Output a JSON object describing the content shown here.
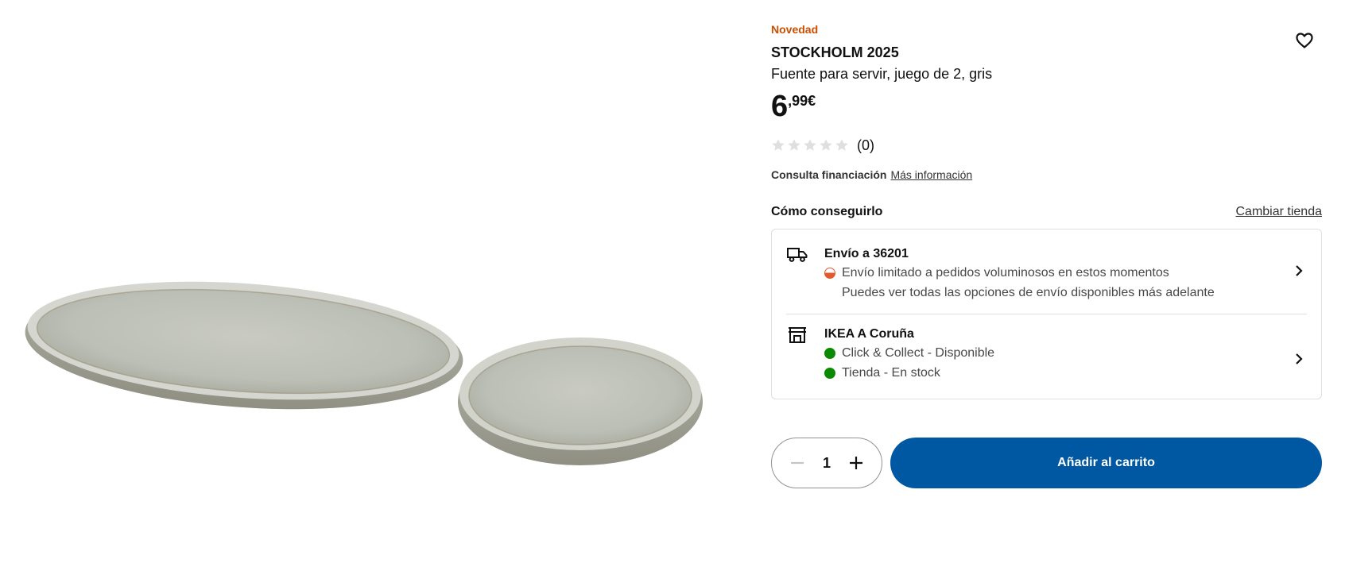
{
  "product": {
    "badge": "Novedad",
    "name": "STOCKHOLM 2025",
    "description": "Fuente para servir, juego de 2, gris",
    "price_int": "6",
    "price_dec": ",99€",
    "image_alt_icon": "serving-dishes-image",
    "favorite_icon": "heart-icon"
  },
  "rating": {
    "stars_total": 5,
    "stars_filled": 0,
    "count_label": "(0)"
  },
  "finance": {
    "label": "Consulta financiación",
    "link": "Más información"
  },
  "availability": {
    "title": "Cómo conseguirlo",
    "change_store": "Cambiar tienda",
    "delivery": {
      "icon": "truck-icon",
      "title": "Envío a 36201",
      "status": "Envío limitado a pedidos voluminosos en estos momentos",
      "status_color": "#e25a2c",
      "note": "Puedes ver todas las opciones de envío disponibles más adelante"
    },
    "store": {
      "icon": "store-icon",
      "title": "IKEA A Coruña",
      "click_collect": "Click & Collect - Disponible",
      "in_store": "Tienda - En stock",
      "status_color": "#0a8a00"
    }
  },
  "cart": {
    "quantity": "1",
    "add_label": "Añadir al carrito",
    "accent": "#0058a3"
  }
}
